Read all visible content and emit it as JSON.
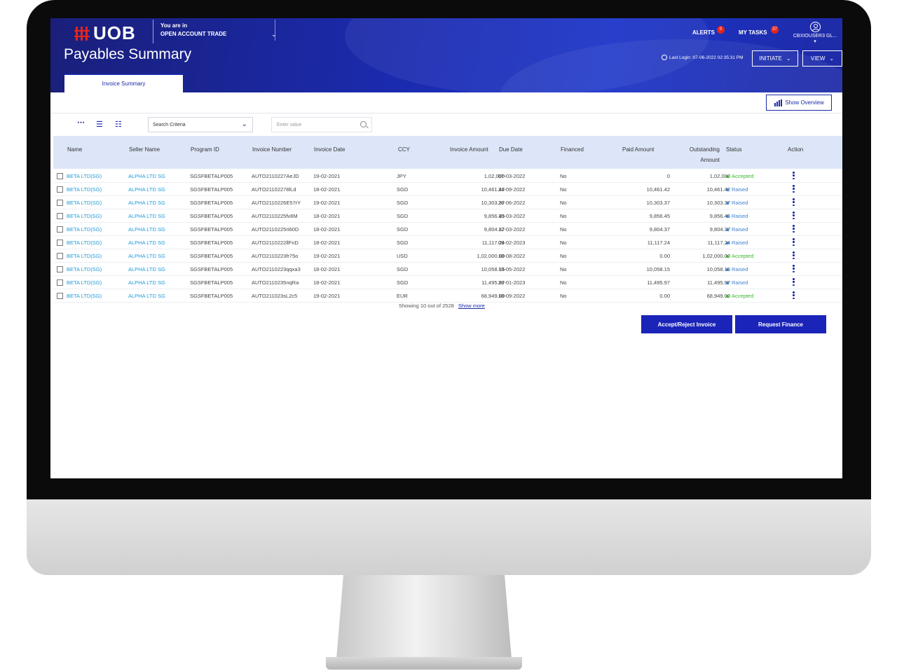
{
  "app": {
    "logo": "UOB",
    "context_label": "You are in",
    "context_value": "OPEN ACCOUNT TRADE",
    "alerts_label": "ALERTS",
    "alerts_count": "0",
    "tasks_label": "MY TASKS",
    "tasks_count": "37",
    "user_name": "CBXIOUSER3 GL..."
  },
  "header": {
    "title": "Payables Summary",
    "last_login": "Last Login :07-06-2022 02:35:31 PM",
    "initiate_label": "INITIATE",
    "view_label": "VIEW"
  },
  "tabs": [
    {
      "label": "Invoice Summary",
      "active": true
    }
  ],
  "toolbar": {
    "show_overview_label": "Show Overview",
    "search_criteria_label": "Search Criteria",
    "search_placeholder": "Enter value"
  },
  "table": {
    "columns": {
      "name": "Name",
      "seller": "Seller Name",
      "program": "Program ID",
      "invoice_no": "Invoice Number",
      "invoice_date": "Invoice Date",
      "ccy": "CCY",
      "amount": "Invoice Amount",
      "due_date": "Due Date",
      "financed": "Financed",
      "paid": "Paid Amount",
      "outstanding_1": "Outstanding",
      "outstanding_2": "Amount",
      "status": "Status",
      "action": "Action"
    },
    "rows": [
      {
        "name": "BETA LTD(SG)",
        "seller": "ALPHA LTD SG",
        "program": "SGSFBETALP005",
        "invoice_no": "AUTO2110227AeJD",
        "invoice_date": "19-02-2021",
        "ccy": "JPY",
        "amount": "1,02,000",
        "due_date": "07-03-2022",
        "financed": "No",
        "paid": "0",
        "outstanding": "1,02,000",
        "status": "Accepted"
      },
      {
        "name": "BETA LTD(SG)",
        "seller": "ALPHA LTD SG",
        "program": "SGSFBETALP005",
        "invoice_no": "AUTO21102278lLd",
        "invoice_date": "18-02-2021",
        "ccy": "SGD",
        "amount": "10,461.42",
        "due_date": "24-09-2022",
        "financed": "No",
        "paid": "10,461.42",
        "outstanding": "10,461.42",
        "status": "Raised"
      },
      {
        "name": "BETA LTD(SG)",
        "seller": "ALPHA LTD SG",
        "program": "SGSFBETALP005",
        "invoice_no": "AUTO2110226E57rY",
        "invoice_date": "19-02-2021",
        "ccy": "SGD",
        "amount": "10,303.37",
        "due_date": "26-06-2022",
        "financed": "No",
        "paid": "10,303.37",
        "outstanding": "10,303.37",
        "status": "Raised"
      },
      {
        "name": "BETA LTD(SG)",
        "seller": "ALPHA LTD SG",
        "program": "SGSFBETALP005",
        "invoice_no": "AUTO2110225fv8M",
        "invoice_date": "18-02-2021",
        "ccy": "SGD",
        "amount": "9,856.45",
        "due_date": "10-03-2022",
        "financed": "No",
        "paid": "9,856.45",
        "outstanding": "9,856.45",
        "status": "Raised"
      },
      {
        "name": "BETA LTD(SG)",
        "seller": "ALPHA LTD SG",
        "program": "SGSFBETALP005",
        "invoice_no": "AUTO2110225ri60D",
        "invoice_date": "18-02-2021",
        "ccy": "SGD",
        "amount": "9,804.37",
        "due_date": "12-03-2022",
        "financed": "No",
        "paid": "9,804.37",
        "outstanding": "9,804.37",
        "status": "Raised"
      },
      {
        "name": "BETA LTD(SG)",
        "seller": "ALPHA LTD SG",
        "program": "SGSFBETALP005",
        "invoice_no": "AUTO2110222llFnD",
        "invoice_date": "18-02-2021",
        "ccy": "SGD",
        "amount": "11,117.24",
        "due_date": "09-02-2023",
        "financed": "No",
        "paid": "11,117.24",
        "outstanding": "11,117.24",
        "status": "Raised"
      },
      {
        "name": "BETA LTD(SG)",
        "seller": "ALPHA LTD SG",
        "program": "SGSFBETALP005",
        "invoice_no": "AUTO2110223fr75o",
        "invoice_date": "19-02-2021",
        "ccy": "USD",
        "amount": "1,02,000.00",
        "due_date": "18-08-2022",
        "financed": "No",
        "paid": "0.00",
        "outstanding": "1,02,000.00",
        "status": "Accepted"
      },
      {
        "name": "BETA LTD(SG)",
        "seller": "ALPHA LTD SG",
        "program": "SGSFBETALP005",
        "invoice_no": "AUTO2110223qqxa3",
        "invoice_date": "18-02-2021",
        "ccy": "SGD",
        "amount": "10,058.15",
        "due_date": "18-05-2022",
        "financed": "No",
        "paid": "10,058.15",
        "outstanding": "10,058.15",
        "status": "Raised"
      },
      {
        "name": "BETA LTD(SG)",
        "seller": "ALPHA LTD SG",
        "program": "SGSFBETALP005",
        "invoice_no": "AUTO2110235nqRa",
        "invoice_date": "18-02-2021",
        "ccy": "SGD",
        "amount": "11,495.97",
        "due_date": "28-01-2023",
        "financed": "No",
        "paid": "11,495.97",
        "outstanding": "11,495.97",
        "status": "Raised"
      },
      {
        "name": "BETA LTD(SG)",
        "seller": "ALPHA LTD SG",
        "program": "SGSFBETALP005",
        "invoice_no": "AUTO211023sL2c5",
        "invoice_date": "19-02-2021",
        "ccy": "EUR",
        "amount": "68,949.00",
        "due_date": "18-09-2022",
        "financed": "No",
        "paid": "0.00",
        "outstanding": "68,949.00",
        "status": "Accepted"
      }
    ]
  },
  "footer": {
    "showing": "Showing 10 out of 2528",
    "show_more": "Show more",
    "accept_reject_label": "Accept/Reject Invoice",
    "request_finance_label": "Request Finance"
  },
  "colors": {
    "brand_blue": "#1b24b8",
    "link": "#1d9ad6",
    "accepted": "#3bb42b",
    "raised": "#3b82d6",
    "uob_red": "#e1261c"
  }
}
